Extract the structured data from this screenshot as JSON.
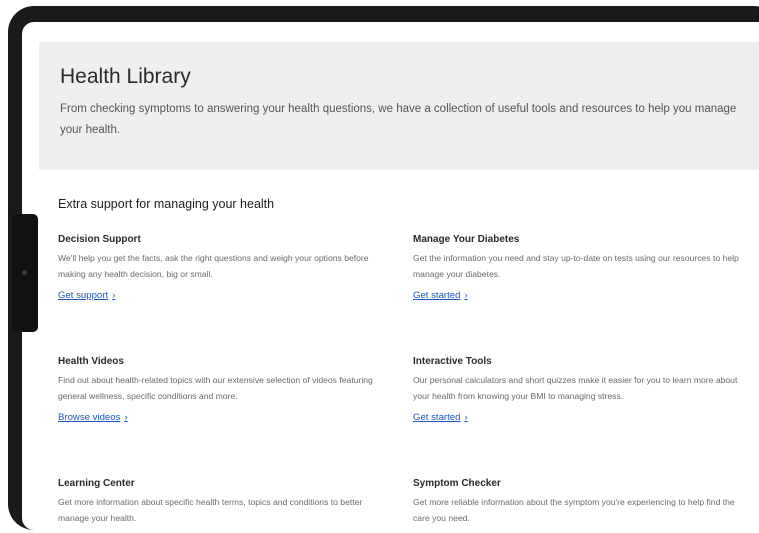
{
  "hero": {
    "title": "Health Library",
    "description": "From checking symptoms to answering your health questions, we have a collection of useful tools and resources to help you manage your health."
  },
  "section": {
    "heading": "Extra support for managing your health"
  },
  "cards": [
    {
      "title": "Decision Support",
      "description": "We'll help you get the facts, ask the right questions and weigh your options before making any health decision, big or small.",
      "link": "Get support"
    },
    {
      "title": "Manage Your Diabetes",
      "description": "Get the information you need and stay up-to-date on tests using our resources to help manage your diabetes.",
      "link": "Get started"
    },
    {
      "title": "Health Videos",
      "description": "Find out about health-related topics with our extensive selection of videos featuring general wellness, specific conditions and more.",
      "link": "Browse videos"
    },
    {
      "title": "Interactive Tools",
      "description": "Our personal calculators and short quizzes make it easier for you to learn more about your health from knowing your BMI to managing stress.",
      "link": "Get started"
    },
    {
      "title": "Learning Center",
      "description": "Get more information about specific health terms, topics and conditions to better manage your health."
    },
    {
      "title": "Symptom Checker",
      "description": "Get more reliable information about the symptom you're experiencing to help find the care you need."
    }
  ],
  "icons": {
    "link_chevron": "chevron-right-icon"
  },
  "colors": {
    "link": "#1a56b8",
    "hero_background": "#efefef",
    "device_frame": "#1a1a1a"
  }
}
